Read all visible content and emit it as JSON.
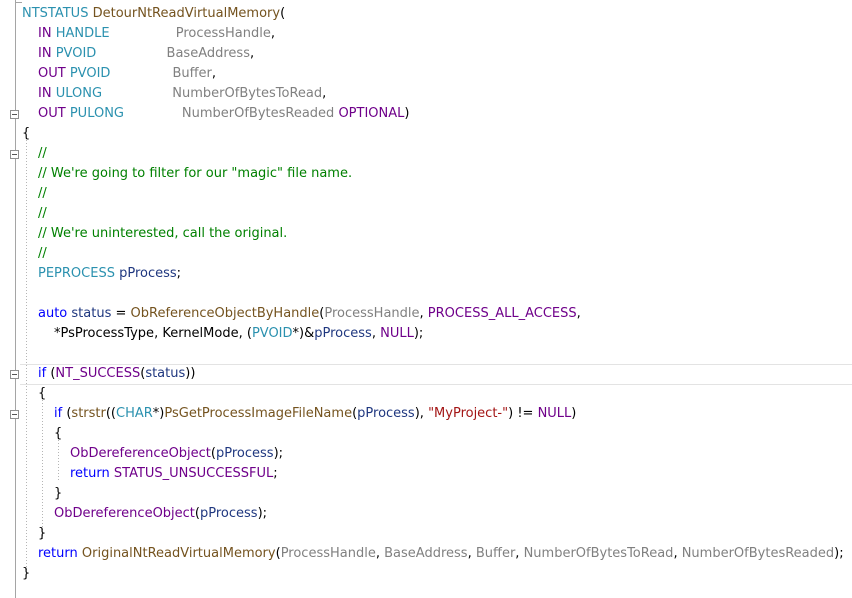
{
  "editor": {
    "theme": {
      "keyword": "#0000ff",
      "type": "#2b91af",
      "function": "#74531f",
      "macro": "#6f008a",
      "parameter": "#808080",
      "comment": "#008000",
      "string": "#a31515",
      "local_variable": "#1f377f",
      "background": "#ffffff"
    },
    "fold_icon": "minus-box-icon",
    "lines": [
      {
        "x": 22,
        "fold": false,
        "tokens": [
          {
            "t": "NTSTATUS",
            "k": "type"
          },
          {
            "t": " ",
            "k": "punc"
          },
          {
            "t": "DetourNtReadVirtualMemory",
            "k": "fn"
          },
          {
            "t": "(",
            "k": "punc"
          }
        ]
      },
      {
        "x": 38,
        "fold": false,
        "tokens": [
          {
            "t": "IN",
            "k": "mac"
          },
          {
            "t": " ",
            "k": "punc"
          },
          {
            "t": "HANDLE",
            "k": "type"
          },
          {
            "t": "                ",
            "k": "punc"
          },
          {
            "t": "ProcessHandle",
            "k": "param"
          },
          {
            "t": ",",
            "k": "punc"
          }
        ]
      },
      {
        "x": 38,
        "fold": false,
        "tokens": [
          {
            "t": "IN",
            "k": "mac"
          },
          {
            "t": " ",
            "k": "punc"
          },
          {
            "t": "PVOID",
            "k": "type"
          },
          {
            "t": "                 ",
            "k": "punc"
          },
          {
            "t": "BaseAddress",
            "k": "param"
          },
          {
            "t": ",",
            "k": "punc"
          }
        ]
      },
      {
        "x": 38,
        "fold": false,
        "tokens": [
          {
            "t": "OUT",
            "k": "mac"
          },
          {
            "t": " ",
            "k": "punc"
          },
          {
            "t": "PVOID",
            "k": "type"
          },
          {
            "t": "               ",
            "k": "punc"
          },
          {
            "t": "Buffer",
            "k": "param"
          },
          {
            "t": ",",
            "k": "punc"
          }
        ]
      },
      {
        "x": 38,
        "fold": false,
        "tokens": [
          {
            "t": "IN",
            "k": "mac"
          },
          {
            "t": " ",
            "k": "punc"
          },
          {
            "t": "ULONG",
            "k": "type"
          },
          {
            "t": "                 ",
            "k": "punc"
          },
          {
            "t": "NumberOfBytesToRead",
            "k": "param"
          },
          {
            "t": ",",
            "k": "punc"
          }
        ]
      },
      {
        "x": 38,
        "fold": true,
        "tokens": [
          {
            "t": "OUT",
            "k": "mac"
          },
          {
            "t": " ",
            "k": "punc"
          },
          {
            "t": "PULONG",
            "k": "type"
          },
          {
            "t": "              ",
            "k": "punc"
          },
          {
            "t": "NumberOfBytesReaded",
            "k": "param"
          },
          {
            "t": " ",
            "k": "punc"
          },
          {
            "t": "OPTIONAL",
            "k": "mac"
          },
          {
            "t": ")",
            "k": "punc"
          }
        ]
      },
      {
        "x": 22,
        "fold": false,
        "tokens": [
          {
            "t": "{",
            "k": "punc"
          }
        ]
      },
      {
        "x": 38,
        "fold": true,
        "tokens": [
          {
            "t": "//",
            "k": "cmt"
          }
        ]
      },
      {
        "x": 38,
        "fold": false,
        "tokens": [
          {
            "t": "// We're going to filter for our \"magic\" file name.",
            "k": "cmt"
          }
        ]
      },
      {
        "x": 38,
        "fold": false,
        "tokens": [
          {
            "t": "//",
            "k": "cmt"
          }
        ]
      },
      {
        "x": 38,
        "fold": false,
        "tokens": [
          {
            "t": "//",
            "k": "cmt"
          }
        ]
      },
      {
        "x": 38,
        "fold": false,
        "tokens": [
          {
            "t": "// We're uninterested, call the original.",
            "k": "cmt"
          }
        ]
      },
      {
        "x": 38,
        "fold": false,
        "tokens": [
          {
            "t": "//",
            "k": "cmt"
          }
        ]
      },
      {
        "x": 38,
        "fold": false,
        "tokens": [
          {
            "t": "PEPROCESS",
            "k": "type"
          },
          {
            "t": " ",
            "k": "punc"
          },
          {
            "t": "pProcess",
            "k": "var"
          },
          {
            "t": ";",
            "k": "punc"
          }
        ]
      },
      {
        "x": 38,
        "fold": false,
        "tokens": []
      },
      {
        "x": 38,
        "fold": false,
        "tokens": [
          {
            "t": "auto",
            "k": "kw"
          },
          {
            "t": " ",
            "k": "punc"
          },
          {
            "t": "status",
            "k": "var"
          },
          {
            "t": " = ",
            "k": "punc"
          },
          {
            "t": "ObReferenceObjectByHandle",
            "k": "fn"
          },
          {
            "t": "(",
            "k": "punc"
          },
          {
            "t": "ProcessHandle",
            "k": "param"
          },
          {
            "t": ", ",
            "k": "punc"
          },
          {
            "t": "PROCESS_ALL_ACCESS",
            "k": "mac"
          },
          {
            "t": ",",
            "k": "punc"
          }
        ]
      },
      {
        "x": 54,
        "fold": false,
        "tokens": [
          {
            "t": "*PsProcessType",
            "k": "id"
          },
          {
            "t": ", ",
            "k": "punc"
          },
          {
            "t": "KernelMode",
            "k": "id"
          },
          {
            "t": ", (",
            "k": "punc"
          },
          {
            "t": "PVOID",
            "k": "type"
          },
          {
            "t": "*)&",
            "k": "punc"
          },
          {
            "t": "pProcess",
            "k": "var"
          },
          {
            "t": ", ",
            "k": "punc"
          },
          {
            "t": "NULL",
            "k": "mac"
          },
          {
            "t": ");",
            "k": "punc"
          }
        ]
      },
      {
        "x": 38,
        "fold": false,
        "tokens": []
      },
      {
        "x": 38,
        "fold": true,
        "tokens": [
          {
            "t": "if",
            "k": "kw"
          },
          {
            "t": " (",
            "k": "punc"
          },
          {
            "t": "NT_SUCCESS",
            "k": "mac"
          },
          {
            "t": "(",
            "k": "punc"
          },
          {
            "t": "status",
            "k": "var"
          },
          {
            "t": "))",
            "k": "punc"
          }
        ]
      },
      {
        "x": 38,
        "fold": false,
        "tokens": [
          {
            "t": "{",
            "k": "punc"
          }
        ]
      },
      {
        "x": 54,
        "fold": true,
        "tokens": [
          {
            "t": "if",
            "k": "kw"
          },
          {
            "t": " (",
            "k": "punc"
          },
          {
            "t": "strstr",
            "k": "fn"
          },
          {
            "t": "((",
            "k": "punc"
          },
          {
            "t": "CHAR",
            "k": "type"
          },
          {
            "t": "*)",
            "k": "punc"
          },
          {
            "t": "PsGetProcessImageFileName",
            "k": "fn"
          },
          {
            "t": "(",
            "k": "punc"
          },
          {
            "t": "pProcess",
            "k": "var"
          },
          {
            "t": "), ",
            "k": "punc"
          },
          {
            "t": "\"MyProject-\"",
            "k": "str"
          },
          {
            "t": ") != ",
            "k": "punc"
          },
          {
            "t": "NULL",
            "k": "mac"
          },
          {
            "t": ")",
            "k": "punc"
          }
        ]
      },
      {
        "x": 54,
        "fold": false,
        "tokens": [
          {
            "t": "{",
            "k": "punc"
          }
        ]
      },
      {
        "x": 70,
        "fold": false,
        "tokens": [
          {
            "t": "ObDereferenceObject",
            "k": "mac"
          },
          {
            "t": "(",
            "k": "punc"
          },
          {
            "t": "pProcess",
            "k": "var"
          },
          {
            "t": ");",
            "k": "punc"
          }
        ]
      },
      {
        "x": 70,
        "fold": false,
        "tokens": [
          {
            "t": "return",
            "k": "kw"
          },
          {
            "t": " ",
            "k": "punc"
          },
          {
            "t": "STATUS_UNSUCCESSFUL",
            "k": "mac"
          },
          {
            "t": ";",
            "k": "punc"
          }
        ]
      },
      {
        "x": 54,
        "fold": false,
        "tokens": [
          {
            "t": "}",
            "k": "punc"
          }
        ]
      },
      {
        "x": 54,
        "fold": false,
        "tokens": [
          {
            "t": "ObDereferenceObject",
            "k": "mac"
          },
          {
            "t": "(",
            "k": "punc"
          },
          {
            "t": "pProcess",
            "k": "var"
          },
          {
            "t": ");",
            "k": "punc"
          }
        ]
      },
      {
        "x": 38,
        "fold": false,
        "tokens": [
          {
            "t": "}",
            "k": "punc"
          }
        ]
      },
      {
        "x": 38,
        "fold": false,
        "tokens": [
          {
            "t": "return",
            "k": "kw"
          },
          {
            "t": " ",
            "k": "punc"
          },
          {
            "t": "OriginalNtReadVirtualMemory",
            "k": "fn"
          },
          {
            "t": "(",
            "k": "punc"
          },
          {
            "t": "ProcessHandle",
            "k": "param"
          },
          {
            "t": ", ",
            "k": "punc"
          },
          {
            "t": "BaseAddress",
            "k": "param"
          },
          {
            "t": ", ",
            "k": "punc"
          },
          {
            "t": "Buffer",
            "k": "param"
          },
          {
            "t": ", ",
            "k": "punc"
          },
          {
            "t": "NumberOfBytesToRead",
            "k": "param"
          },
          {
            "t": ", ",
            "k": "punc"
          },
          {
            "t": "NumberOfBytesReaded",
            "k": "param"
          },
          {
            "t": ");",
            "k": "punc"
          }
        ]
      },
      {
        "x": 22,
        "fold": false,
        "tokens": [
          {
            "t": "}",
            "k": "punc"
          }
        ]
      }
    ]
  }
}
